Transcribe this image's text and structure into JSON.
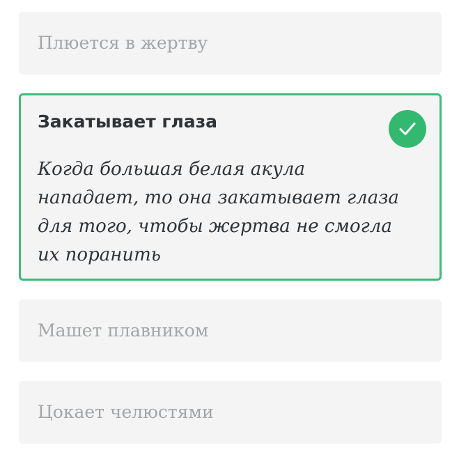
{
  "quiz": {
    "options": [
      {
        "label": "Плюется в жертву",
        "state": "unselected"
      },
      {
        "label": "Закатывает глаза",
        "description": "Когда большая белая акула нападает, то она закатывает глаза для того, чтобы жертва не смогла их поранить",
        "state": "correct",
        "icon": "checkmark-icon"
      },
      {
        "label": "Машет плавником",
        "state": "unselected"
      },
      {
        "label": "Цокает челюстями",
        "state": "unselected"
      }
    ]
  },
  "colors": {
    "correct_border": "#3dbb78",
    "correct_badge": "#33b96f",
    "option_background": "#f4f4f4",
    "muted_text": "#a3a6a9",
    "dark_text": "#2e3338"
  }
}
